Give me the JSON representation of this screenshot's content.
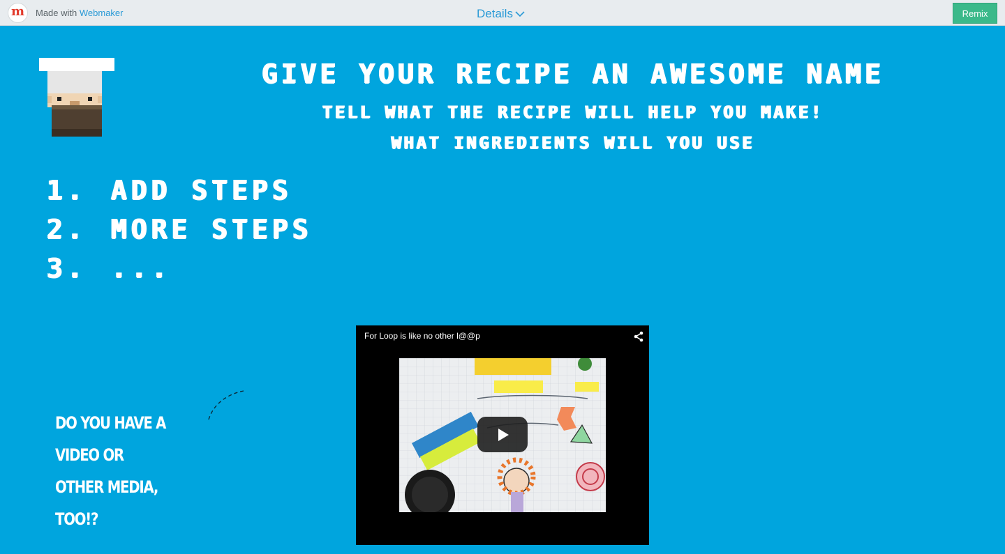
{
  "topbar": {
    "logo_letter": "m",
    "made_with": "Made with",
    "webmaker": "Webmaker",
    "details": "Details",
    "remix": "Remix"
  },
  "heading": {
    "title": "Give your recipe an awesome name",
    "subtitle": "Tell what the recipe will help you make!",
    "subtitle2": "What ingredients will you use"
  },
  "steps": [
    {
      "num": "1.",
      "text": "Add steps"
    },
    {
      "num": "2.",
      "text": "More steps"
    },
    {
      "num": "3.",
      "text": "..."
    }
  ],
  "note": {
    "line1": "Do you have a video or",
    "line2": "other media, too!?"
  },
  "video": {
    "title": "For Loop is like no other l@@p"
  },
  "icons": {
    "details": "chevron-down-icon",
    "share": "share-icon",
    "play": "play-icon"
  },
  "colors": {
    "background": "#00a5de",
    "topbar": "#e8ecef",
    "link": "#2a9ad6",
    "remix": "#3bb98a",
    "text": "#ffffff"
  }
}
